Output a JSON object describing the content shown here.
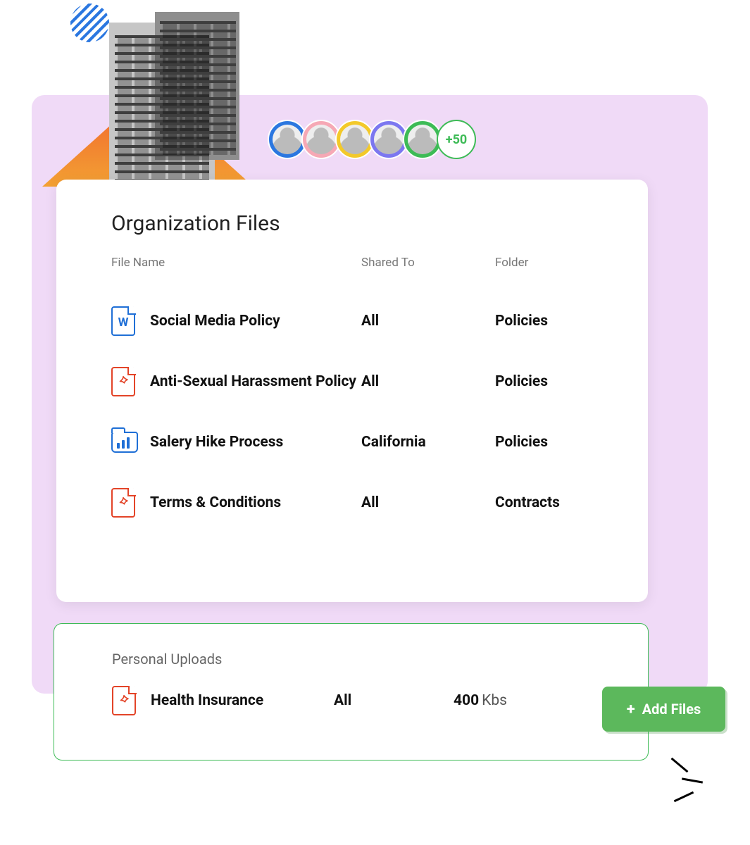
{
  "avatars": {
    "overflow_label": "+50"
  },
  "org": {
    "title": "Organization Files",
    "headers": {
      "file_name": "File Name",
      "shared_to": "Shared To",
      "folder": "Folder"
    },
    "rows": [
      {
        "icon": "word",
        "name": "Social Media Policy",
        "shared": "All",
        "folder": "Policies"
      },
      {
        "icon": "pdf",
        "name": "Anti-Sexual Harassment Policy",
        "shared": "All",
        "folder": "Policies"
      },
      {
        "icon": "folder",
        "name": "Salery Hike Process",
        "shared": "California",
        "folder": "Policies"
      },
      {
        "icon": "pdf",
        "name": "Terms & Conditions",
        "shared": "All",
        "folder": "Contracts"
      }
    ]
  },
  "personal": {
    "title": "Personal Uploads",
    "row": {
      "icon": "pdf",
      "name": "Health Insurance",
      "shared": "All",
      "size_value": "400",
      "size_unit": "Kbs"
    }
  },
  "add_button": {
    "label": "Add Files"
  },
  "colors": {
    "green": "#3dbb56",
    "blue": "#1f6fd6",
    "red": "#e34428",
    "purple_bg": "#f0daf7"
  }
}
